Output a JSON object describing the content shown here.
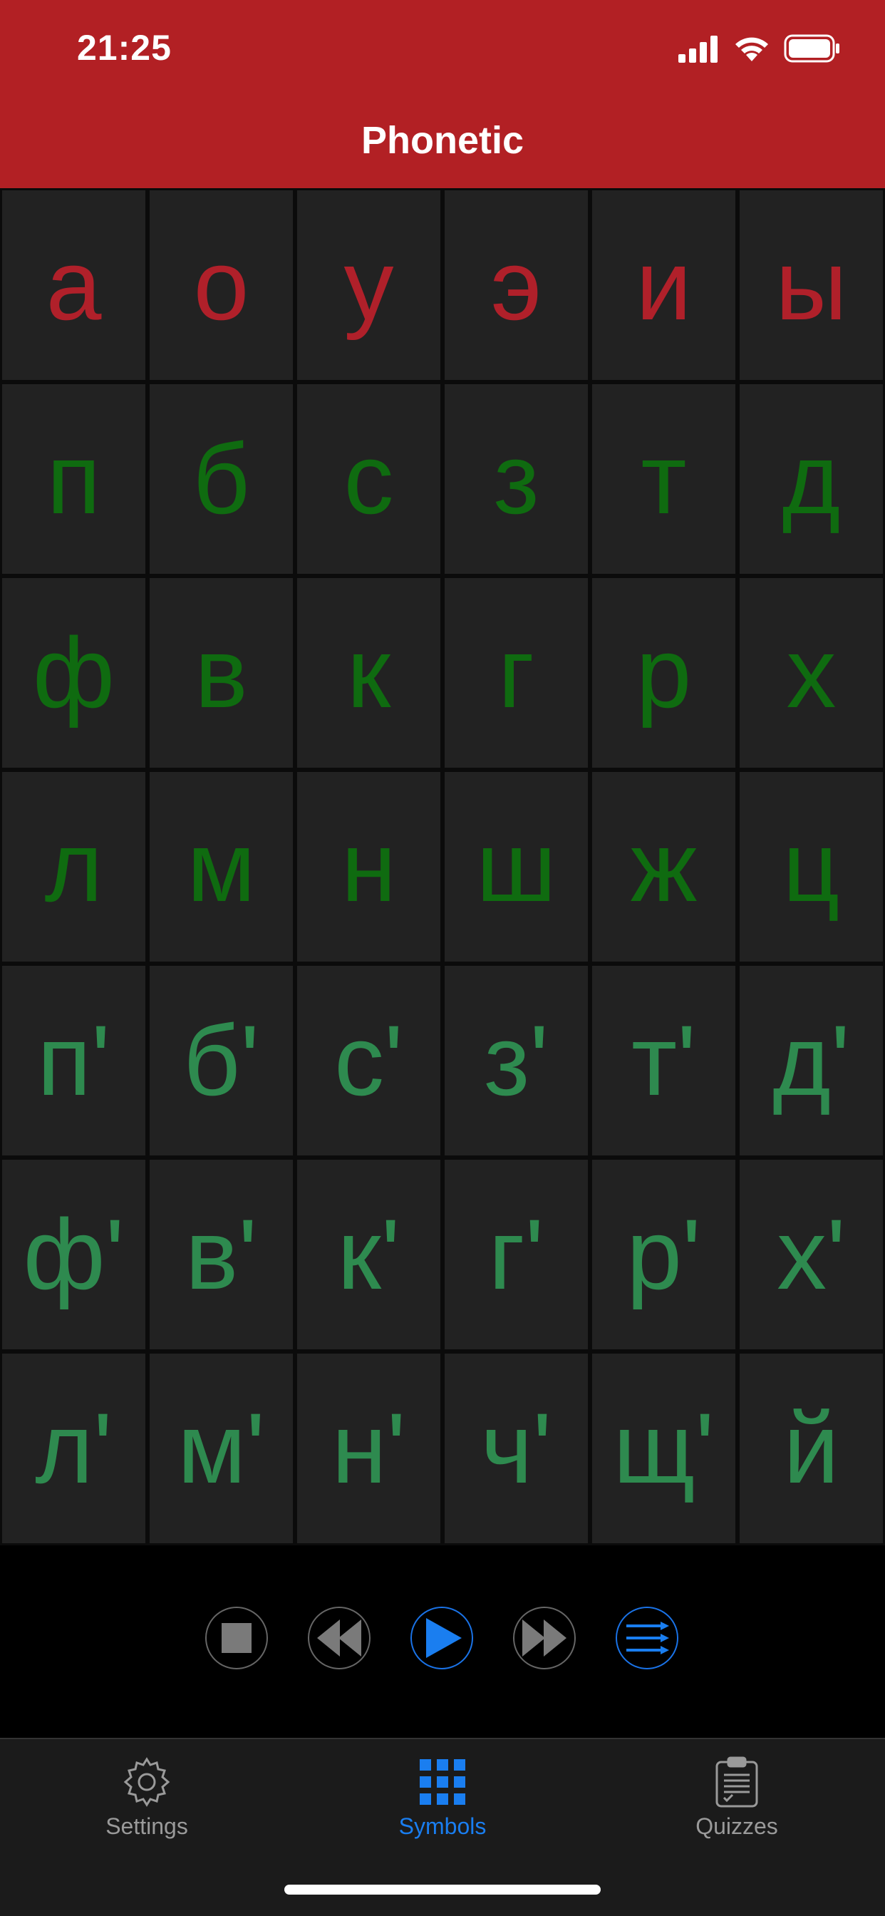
{
  "status_bar": {
    "time": "21:25"
  },
  "nav": {
    "title": "Phonetic"
  },
  "colors": {
    "vowel": "#b0202a",
    "hard_consonant": "#0f6b10",
    "soft_consonant": "#2e8a4f",
    "accent": "#1a7ef0"
  },
  "grid": {
    "rows": [
      {
        "type": "vowel",
        "cells": [
          "а",
          "о",
          "у",
          "э",
          "и",
          "ы"
        ]
      },
      {
        "type": "hard_consonant",
        "cells": [
          "п",
          "б",
          "с",
          "з",
          "т",
          "д"
        ]
      },
      {
        "type": "hard_consonant",
        "cells": [
          "ф",
          "в",
          "к",
          "г",
          "р",
          "х"
        ]
      },
      {
        "type": "hard_consonant",
        "cells": [
          "л",
          "м",
          "н",
          "ш",
          "ж",
          "ц"
        ]
      },
      {
        "type": "soft_consonant",
        "cells": [
          "п'",
          "б'",
          "с'",
          "з'",
          "т'",
          "д'"
        ]
      },
      {
        "type": "soft_consonant",
        "cells": [
          "ф'",
          "в'",
          "к'",
          "г'",
          "р'",
          "х'"
        ]
      },
      {
        "type": "soft_consonant",
        "cells": [
          "л'",
          "м'",
          "н'",
          "ч'",
          "щ'",
          "й"
        ]
      }
    ]
  },
  "controls": {
    "buttons": [
      "stop-icon",
      "rewind-icon",
      "play-icon",
      "fast-forward-icon",
      "playlist-icon"
    ]
  },
  "tabs": [
    {
      "label": "Settings",
      "icon": "gear-icon",
      "active": false
    },
    {
      "label": "Symbols",
      "icon": "grid-icon",
      "active": true
    },
    {
      "label": "Quizzes",
      "icon": "clipboard-icon",
      "active": false
    }
  ]
}
